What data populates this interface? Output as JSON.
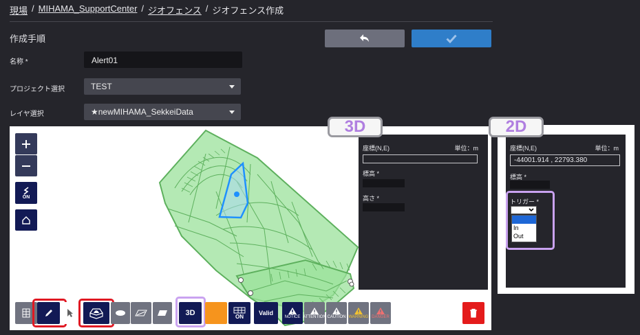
{
  "breadcrumb": {
    "items": [
      "現場",
      "MIHAMA_SupportCenter",
      "ジオフェンス",
      "ジオフェンス作成"
    ],
    "sep": "/"
  },
  "page": {
    "section_title": "作成手順"
  },
  "form": {
    "name_label": "名称 *",
    "name_value": "Alert01",
    "project_label": "プロジェクト選択",
    "project_value": "TEST",
    "layer_label": "レイヤ選択",
    "layer_value": "★newMIHAMA_SekkeiData"
  },
  "map_controls": {
    "toggle_label": "ON"
  },
  "panel3d": {
    "badge": "3D",
    "coord_label": "座標(N,E)",
    "unit_label": "単位：m",
    "coord_value": "",
    "elev_label": "標高 *",
    "height_label": "高さ *"
  },
  "panel2d": {
    "badge": "2D",
    "coord_label": "座標(N,E)",
    "unit_label": "単位：m",
    "coord_value": "-44001.914 , 22793.380",
    "elev_label": "標高 *",
    "trigger_label": "トリガー *",
    "trigger_options": [
      "",
      "In",
      "Out"
    ]
  },
  "toolbar": {
    "btn_3d": "3D",
    "btn_on": "ON",
    "btn_valid": "Valid",
    "levels": [
      {
        "label": "NOTICE",
        "color": "#121a55"
      },
      {
        "label": "ATTENTION",
        "color": "#707380"
      },
      {
        "label": "CAUTION",
        "color": "#707380"
      },
      {
        "label": "WARNING",
        "color": "#f2c230"
      },
      {
        "label": "DANGER",
        "color": "#f07070"
      }
    ]
  },
  "colors": {
    "background": "#25252b",
    "polygon_fill": "#9be29b",
    "polygon_stroke": "#5db05d",
    "selection": "#1e90ff",
    "ok_button": "#2f7ec9",
    "highlight_red": "#e01822",
    "highlight_purple": "#c9a2f0"
  }
}
